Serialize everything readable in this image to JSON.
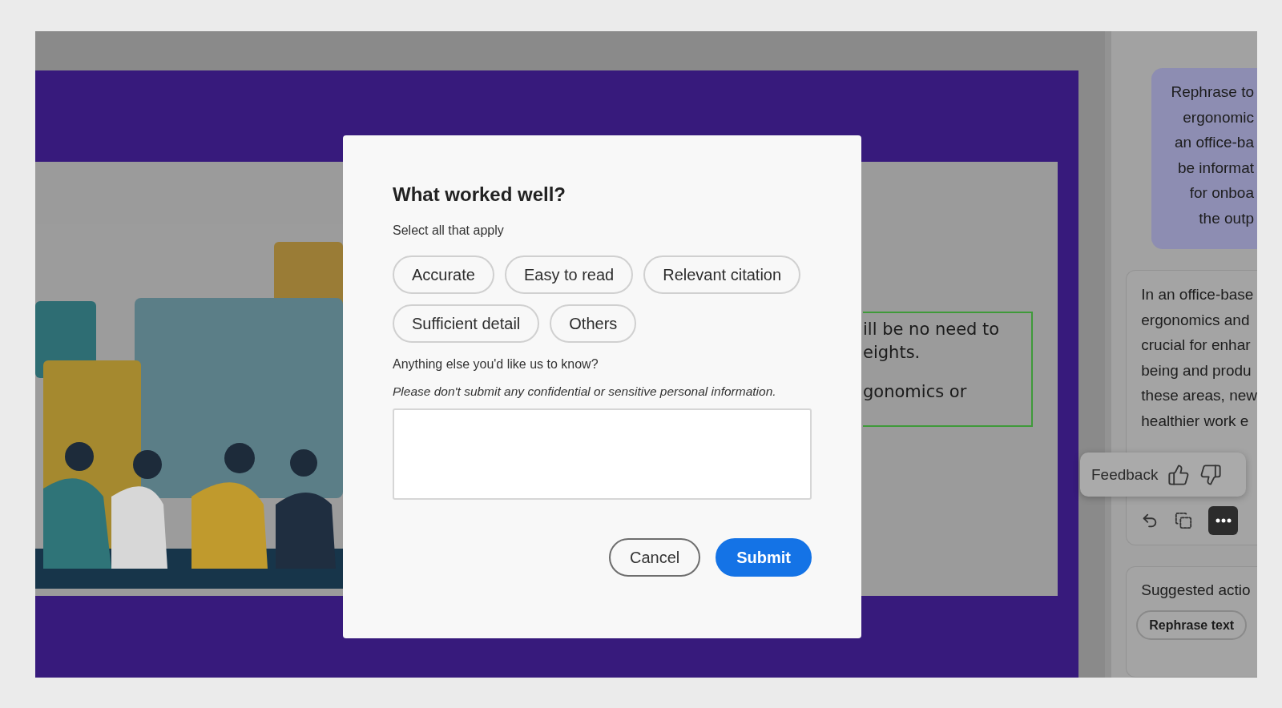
{
  "slide": {
    "image": {
      "kind": "picture"
    },
    "text_paragraphs": [
      [
        "ill be no need to",
        "eights."
      ],
      [
        "gonomics or"
      ]
    ]
  },
  "assistant_panel": {
    "prompt_lines": [
      "Rephrase to",
      "ergonomic",
      "an office-ba",
      "be informat",
      "for onboa",
      "the outp"
    ],
    "response_lines": [
      "In an office-base",
      "ergonomics and",
      "crucial for enhar",
      "being and produ",
      "these areas, new",
      "healthier work e"
    ],
    "feedback": {
      "label": "Feedback"
    },
    "suggested": {
      "title": "Suggested actio",
      "actions": [
        "Rephrase text"
      ]
    }
  },
  "dialog": {
    "title": "What worked well?",
    "subtitle": "Select all that apply",
    "options": [
      {
        "label": "Accurate",
        "selected": false
      },
      {
        "label": "Easy to read",
        "selected": false
      },
      {
        "label": "Relevant citation",
        "selected": false
      },
      {
        "label": "Sufficient detail",
        "selected": false
      },
      {
        "label": "Others",
        "selected": false
      }
    ],
    "comment_label": "Anything else you'd like us to know?",
    "notice": "Please don't submit any confidential or sensitive personal information.",
    "buttons": [
      {
        "label": "Cancel",
        "kind": "secondary"
      },
      {
        "label": "Submit",
        "kind": "primary"
      }
    ]
  }
}
